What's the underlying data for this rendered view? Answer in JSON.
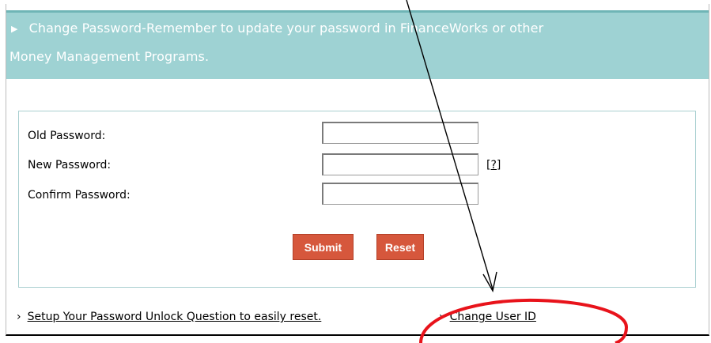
{
  "header": {
    "line1": "Change Password-Remember to update your password in FinanceWorks or other",
    "line2": "Money Management Programs."
  },
  "form": {
    "old_password_label": "Old Password:",
    "new_password_label": "New Password:",
    "confirm_password_label": "Confirm Password:",
    "old_password_value": "",
    "new_password_value": "",
    "confirm_password_value": "",
    "help_link": "[?]",
    "submit_label": "Submit",
    "reset_label": "Reset"
  },
  "footer": {
    "arrow": "›",
    "unlock_link": "Setup Your Password Unlock Question to easily reset.",
    "change_userid_link": "Change User ID"
  },
  "annotation": {
    "arrow_color": "#000000",
    "circle_color": "#e8131b"
  }
}
